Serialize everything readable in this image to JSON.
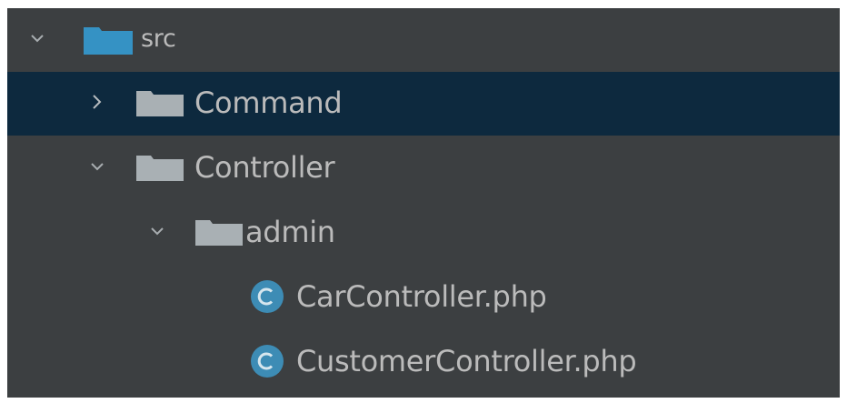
{
  "tree": {
    "src": {
      "label": "src",
      "icon": "folder-icon",
      "color": "#3592c4",
      "expanded": true
    },
    "command": {
      "label": "Command",
      "icon": "folder-icon",
      "expanded": false,
      "selected": true
    },
    "controller": {
      "label": "Controller",
      "icon": "folder-icon",
      "expanded": true
    },
    "admin": {
      "label": "admin",
      "icon": "folder-icon",
      "expanded": true
    },
    "files": [
      {
        "label": "CarController.php",
        "icon": "php-class-icon"
      },
      {
        "label": "CustomerController.php",
        "icon": "php-class-icon"
      }
    ]
  },
  "colors": {
    "panel_bg": "#3c3f41",
    "selection_bg": "#0d293e",
    "text": "#bbbbbb",
    "source_folder": "#3592c4",
    "folder": "#a9b0b4",
    "class_icon": "#3d8cb5"
  }
}
